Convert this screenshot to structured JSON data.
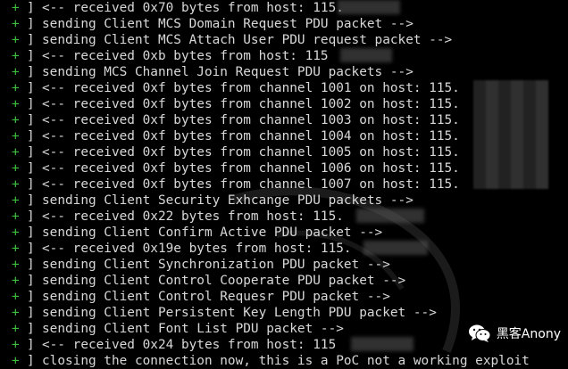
{
  "terminal": {
    "prefix_plus": "+",
    "prefix_bracket": "]",
    "lines": [
      "<-- received 0x70 bytes from host: 115.",
      "sending Client MCS Domain Request PDU packet -->",
      "sending Client MCS Attach User PDU request packet -->",
      "<-- received 0xb bytes from host: 115",
      "sending MCS Channel Join Request PDU packets -->",
      "<-- received 0xf bytes from channel 1001 on host: 115.",
      "<-- received 0xf bytes from channel 1002 on host: 115.",
      "<-- received 0xf bytes from channel 1003 on host: 115.",
      "<-- received 0xf bytes from channel 1004 on host: 115.",
      "<-- received 0xf bytes from channel 1005 on host: 115.",
      "<-- received 0xf bytes from channel 1006 on host: 115.",
      "<-- received 0xf bytes from channel 1007 on host: 115.",
      "sending Client Security Exhcange PDU packets -->",
      "<-- received 0x22 bytes from host: 115.",
      "sending Client Confirm Active PDU packet -->",
      "<-- received 0x19e bytes from host: 115.",
      "sending Client Synchronization PDU packet -->",
      "sending Client Control Cooperate PDU packet -->",
      "sending Client Control Requesr PDU packet -->",
      "sending Client Persistent Key Length PDU packet -->",
      "sending Client Font List PDU packet -->",
      "<-- received 0x24 bytes from host: 115",
      "closing the connection now, this is a PoC not a working exploit"
    ]
  },
  "watermark": {
    "label": "黑客Anony",
    "icon": "wechat-icon"
  },
  "colors": {
    "background": "#000000",
    "text": "#d8d8d8",
    "plus": "#3fbf3f"
  }
}
